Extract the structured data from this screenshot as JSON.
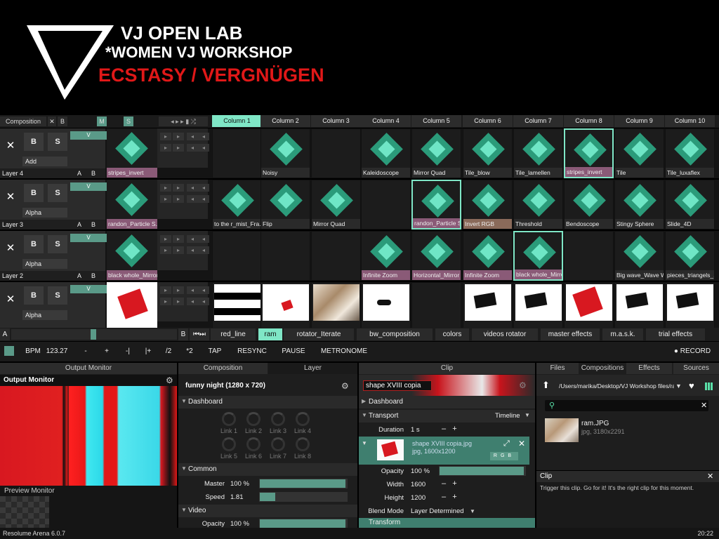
{
  "banner": {
    "line1": "VJ OPEN LAB",
    "line2": "*WOMEN VJ WORKSHOP",
    "line3": "ECSTASY / VERGNÜGEN"
  },
  "toolbar": {
    "composition": "Composition",
    "x": "✕",
    "b": "B",
    "m": "M",
    "s": "S"
  },
  "columns": [
    "Column 1",
    "Column 2",
    "Column 3",
    "Column 4",
    "Column 5",
    "Column 6",
    "Column 7",
    "Column 8",
    "Column 9",
    "Column 10"
  ],
  "layers": [
    {
      "name": "Layer 4",
      "blend": "Add",
      "preview": "stripes_invert",
      "clips": [
        "",
        "Noisy",
        "",
        "Kaleidoscope",
        "Mirror Quad",
        "Tile_blow",
        "Tile_lamellen",
        "stripes_invert",
        "Tile",
        "Tile_luxaflex"
      ]
    },
    {
      "name": "Layer 3",
      "blend": "Alpha",
      "preview": "randon_Particle S...",
      "clips": [
        "to the r_mist_Fra...",
        "Flip",
        "Mirror Quad",
        "",
        "randon_Particle S...",
        "Invert RGB",
        "Threshold",
        "Bendoscope",
        "Stingy Sphere",
        "Slide_4D"
      ]
    },
    {
      "name": "Layer 2",
      "blend": "Alpha",
      "preview": "black whole_Mirror",
      "clips": [
        "",
        "",
        "",
        "Infinite Zoom",
        "Horizontal_Mirror",
        "Infinite Zoom",
        "black whole_Mirror",
        "",
        "Big wave_Wave Warp",
        "pieces_triangels_..."
      ]
    },
    {
      "name": "",
      "blend": "Alpha",
      "preview": "",
      "clips": [
        "",
        "",
        "",
        "",
        "",
        "",
        "",
        "",
        "",
        ""
      ]
    }
  ],
  "layer_btn": {
    "b": "B",
    "s": "S",
    "a": "A",
    "v": "V"
  },
  "decks": [
    "red_line",
    "ram",
    "rotator_Iterate",
    "bw_composition",
    "colors",
    "videos rotator",
    "master effects",
    "m.a.s.k.",
    "trial effects"
  ],
  "deck_a": "A",
  "deck_b": "B",
  "bpm": {
    "label": "BPM",
    "value": "123.27",
    "minus": "-",
    "plus": "+",
    "prev": "-|",
    "next": "|+",
    "half": "/2",
    "double": "*2",
    "tap": "TAP",
    "resync": "RESYNC",
    "pause": "PAUSE",
    "metronome": "METRONOME",
    "record": "● RECORD"
  },
  "output": {
    "header": "Output Monitor",
    "title": "Output Monitor",
    "preview": "Preview Monitor"
  },
  "comp": {
    "tab1": "Composition",
    "tab2": "Layer",
    "title": "funny night (1280 x 720)",
    "dashboard": "Dashboard",
    "links": [
      "Link 1",
      "Link 2",
      "Link 3",
      "Link 4",
      "Link 5",
      "Link 6",
      "Link 7",
      "Link 8"
    ],
    "common": "Common",
    "master_label": "Master",
    "master_val": "100 %",
    "master_level": 0.98,
    "speed_label": "Speed",
    "speed_val": "1.81",
    "speed_level": 0.18,
    "video": "Video",
    "opacity_label": "Opacity",
    "opacity_val": "100 %",
    "opacity_level": 0.98
  },
  "clip": {
    "header": "Clip",
    "name": "shape XVIII copia",
    "dashboard": "Dashboard",
    "transport": "Transport",
    "timeline": "Timeline",
    "duration_label": "Duration",
    "duration_val": "1 s",
    "file": "shape XVIII copia.jpg",
    "fileinfo": "jpg, 1600x1200",
    "opacity_label": "Opacity",
    "opacity_val": "100 %",
    "opacity_level": 0.98,
    "width_label": "Width",
    "width_val": "1600",
    "height_label": "Height",
    "height_val": "1200",
    "blend_label": "Blend Mode",
    "blend_val": "Layer Determined",
    "transform": "Transform",
    "rgb": [
      "R",
      "G",
      "B"
    ]
  },
  "files": {
    "tabs": [
      "Files",
      "Compositions",
      "Effects",
      "Sources"
    ],
    "path": "/Users/marika/Desktop/VJ Workshop files/ram",
    "item": "ram.JPG",
    "iteminfo": "jpg, 3180x2291"
  },
  "clipinfo": {
    "title": "Clip",
    "text": "Trigger this clip. Go for it! It's the right clip for this moment."
  },
  "footer": {
    "app": "Resolume Arena 6.0.7",
    "time": "20:22"
  }
}
